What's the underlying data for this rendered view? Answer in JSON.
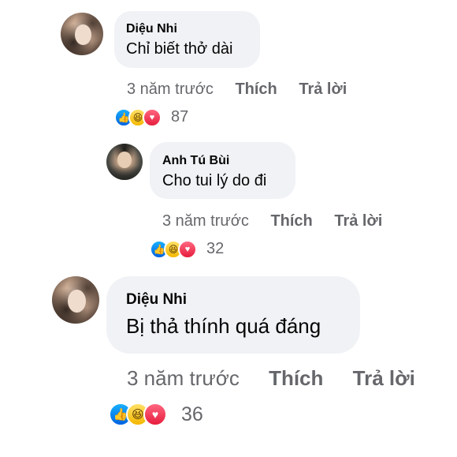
{
  "comments": [
    {
      "author": "Diệu Nhi",
      "text": "Chỉ biết thở dài",
      "time": "3 năm trước",
      "like_label": "Thích",
      "reply_label": "Trả lời",
      "reaction_count": "87",
      "reactions": [
        "like-icon",
        "haha-icon",
        "love-icon"
      ]
    },
    {
      "author": "Anh Tú Bùi",
      "text": "Cho tui lý do đi",
      "time": "3 năm trước",
      "like_label": "Thích",
      "reply_label": "Trả lời",
      "reaction_count": "32",
      "reactions": [
        "like-icon",
        "haha-icon",
        "love-icon"
      ]
    },
    {
      "author": "Diệu Nhi",
      "text": "Bị thả thính quá đáng",
      "time": "3 năm trước",
      "like_label": "Thích",
      "reply_label": "Trả lời",
      "reaction_count": "36",
      "reactions": [
        "like-icon",
        "haha-icon",
        "love-icon"
      ]
    }
  ],
  "colors": {
    "bubble": "#f0f2f5",
    "meta_text": "#65676b",
    "like_blue": "#0062df",
    "love_red": "#e61e3d",
    "haha_yellow": "#f5b800"
  }
}
